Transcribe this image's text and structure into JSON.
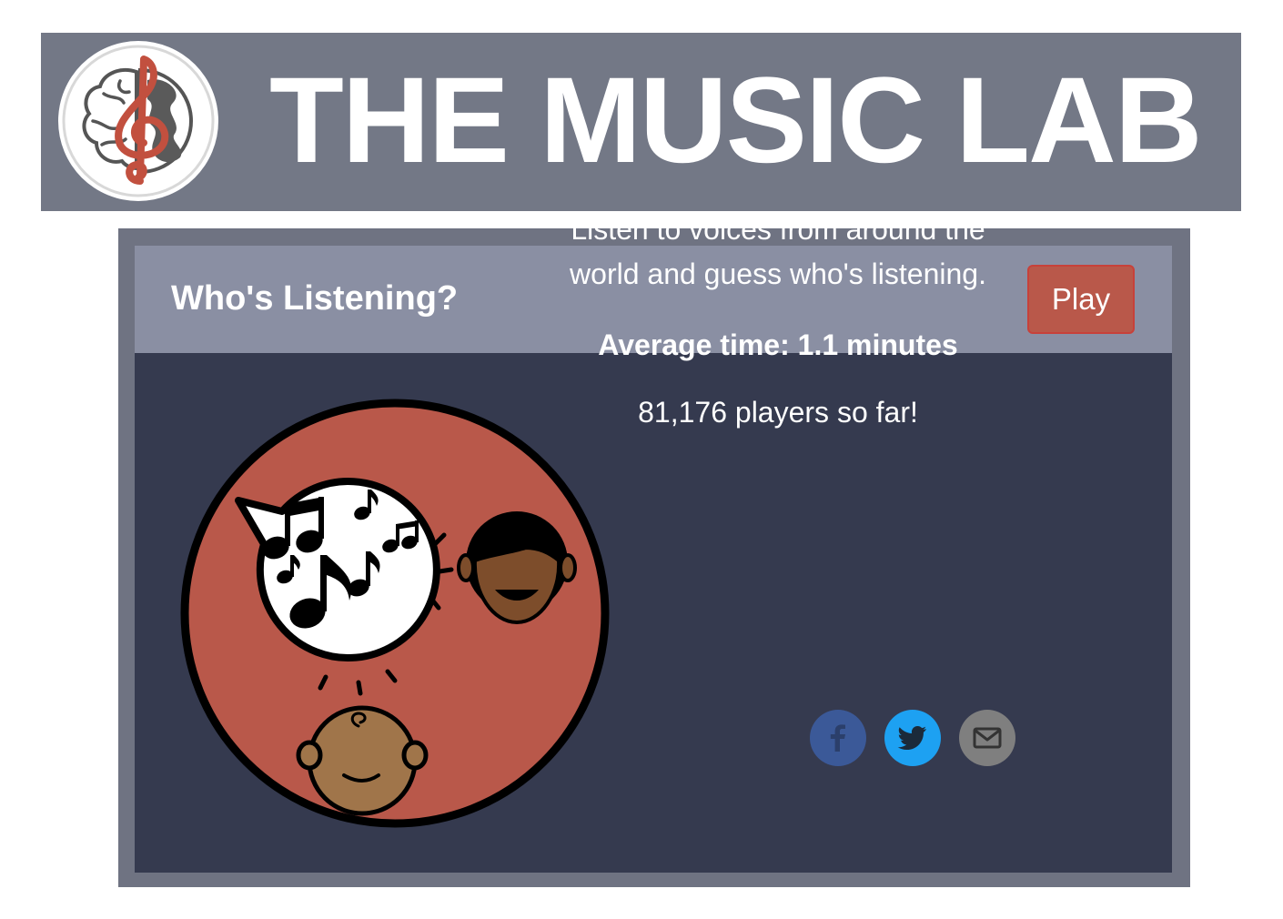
{
  "banner": {
    "title": "THE MUSIC LAB",
    "logo_icon": "brain-treble-clef-globe-logo",
    "background_color": "#737886",
    "accent_color": "#c2503f"
  },
  "card": {
    "title": "Who's Listening?",
    "play_label": "Play",
    "play_color": "#b9584a",
    "header_color": "#8a8fa3",
    "body_color": "#353a4f",
    "illustration_icon": "singing-voice-listeners-illustration",
    "description": "Listen to voices from around the world and guess who's listening.",
    "average_time": "Average time: 1.1 minutes",
    "players": "81,176 players so far!"
  },
  "share": [
    {
      "icon": "facebook-icon",
      "color": "#3b5998"
    },
    {
      "icon": "twitter-icon",
      "color": "#1da1f2"
    },
    {
      "icon": "email-icon",
      "color": "#7f7f7f"
    }
  ]
}
